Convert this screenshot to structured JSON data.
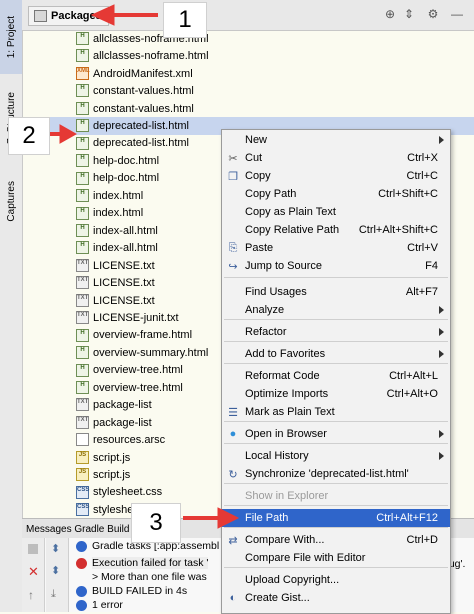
{
  "sidebar": {
    "project_tab": "1: Project",
    "structure_tab": "7: Structure",
    "captures_tab": "Captures"
  },
  "header": {
    "view_label": "Packages"
  },
  "tree": {
    "files": [
      {
        "name": "allclasses-noframe.html",
        "kind": "html"
      },
      {
        "name": "allclasses-noframe.html",
        "kind": "html"
      },
      {
        "name": "AndroidManifest.xml",
        "kind": "xml"
      },
      {
        "name": "constant-values.html",
        "kind": "html"
      },
      {
        "name": "constant-values.html",
        "kind": "html"
      },
      {
        "name": "deprecated-list.html",
        "kind": "html"
      },
      {
        "name": "deprecated-list.html",
        "kind": "html"
      },
      {
        "name": "help-doc.html",
        "kind": "html"
      },
      {
        "name": "help-doc.html",
        "kind": "html"
      },
      {
        "name": "index.html",
        "kind": "html"
      },
      {
        "name": "index.html",
        "kind": "html"
      },
      {
        "name": "index-all.html",
        "kind": "html"
      },
      {
        "name": "index-all.html",
        "kind": "html"
      },
      {
        "name": "LICENSE.txt",
        "kind": "txt"
      },
      {
        "name": "LICENSE.txt",
        "kind": "txt"
      },
      {
        "name": "LICENSE.txt",
        "kind": "txt"
      },
      {
        "name": "LICENSE-junit.txt",
        "kind": "txt"
      },
      {
        "name": "overview-frame.html",
        "kind": "html"
      },
      {
        "name": "overview-summary.html",
        "kind": "html"
      },
      {
        "name": "overview-tree.html",
        "kind": "html"
      },
      {
        "name": "overview-tree.html",
        "kind": "html"
      },
      {
        "name": "package-list",
        "kind": "txt"
      },
      {
        "name": "package-list",
        "kind": "txt"
      },
      {
        "name": "resources.arsc",
        "kind": "arsc"
      },
      {
        "name": "script.js",
        "kind": "js"
      },
      {
        "name": "script.js",
        "kind": "js"
      },
      {
        "name": "stylesheet.css",
        "kind": "css"
      },
      {
        "name": "stylesheet.css",
        "kind": "css"
      }
    ],
    "selected_index": 5
  },
  "messages": {
    "tab_label": "Messages Gradle Build",
    "lines": [
      "Gradle tasks [:app:assembl",
      "Execution failed for task '",
      "> More than one file was",
      "BUILD FAILED in 4s",
      "1 error"
    ],
    "right_fragment": "bug'."
  },
  "context_menu": {
    "items": [
      {
        "label": "New",
        "shortcut": "",
        "submenu": true,
        "icon": ""
      },
      {
        "label": "Cut",
        "shortcut": "Ctrl+X",
        "submenu": false,
        "icon": "scissors-icon"
      },
      {
        "label": "Copy",
        "shortcut": "Ctrl+C",
        "submenu": false,
        "icon": "copy-icon"
      },
      {
        "label": "Copy Path",
        "shortcut": "Ctrl+Shift+C",
        "submenu": false,
        "icon": ""
      },
      {
        "label": "Copy as Plain Text",
        "shortcut": "",
        "submenu": false,
        "icon": ""
      },
      {
        "label": "Copy Relative Path",
        "shortcut": "Ctrl+Alt+Shift+C",
        "submenu": false,
        "icon": ""
      },
      {
        "label": "Paste",
        "shortcut": "Ctrl+V",
        "submenu": false,
        "icon": "paste-icon"
      },
      {
        "label": "Jump to Source",
        "shortcut": "F4",
        "submenu": false,
        "icon": "jump-to-source-icon"
      },
      {
        "label": "Find Usages",
        "shortcut": "Alt+F7",
        "submenu": false,
        "icon": ""
      },
      {
        "label": "Analyze",
        "shortcut": "",
        "submenu": true,
        "icon": ""
      },
      {
        "label": "Refactor",
        "shortcut": "",
        "submenu": true,
        "icon": ""
      },
      {
        "label": "Add to Favorites",
        "shortcut": "",
        "submenu": true,
        "icon": ""
      },
      {
        "label": "Reformat Code",
        "shortcut": "Ctrl+Alt+L",
        "submenu": false,
        "icon": ""
      },
      {
        "label": "Optimize Imports",
        "shortcut": "Ctrl+Alt+O",
        "submenu": false,
        "icon": ""
      },
      {
        "label": "Mark as Plain Text",
        "shortcut": "",
        "submenu": false,
        "icon": "plain-text-icon"
      },
      {
        "label": "Open in Browser",
        "shortcut": "",
        "submenu": true,
        "icon": "globe-icon"
      },
      {
        "label": "Local History",
        "shortcut": "",
        "submenu": true,
        "icon": ""
      },
      {
        "label": "Synchronize 'deprecated-list.html'",
        "shortcut": "",
        "submenu": false,
        "icon": "sync-icon"
      },
      {
        "label": "Show in Explorer",
        "shortcut": "",
        "submenu": false,
        "icon": "",
        "disabled": true
      },
      {
        "label": "File Path",
        "shortcut": "Ctrl+Alt+F12",
        "submenu": false,
        "icon": "",
        "highlighted": true
      },
      {
        "label": "Compare With...",
        "shortcut": "Ctrl+D",
        "submenu": false,
        "icon": "compare-icon"
      },
      {
        "label": "Compare File with Editor",
        "shortcut": "",
        "submenu": false,
        "icon": ""
      },
      {
        "label": "Upload Copyright...",
        "shortcut": "",
        "submenu": false,
        "icon": ""
      },
      {
        "label": "Create Gist...",
        "shortcut": "",
        "submenu": false,
        "icon": "github-icon"
      }
    ]
  },
  "annotations": {
    "step1": "1",
    "step2": "2",
    "step3": "3",
    "arrow_color": "#e53935"
  },
  "colors": {
    "menu_highlight": "#2f65ca",
    "selection": "#c7d5ee",
    "tree_bg": "#fbfbf0"
  }
}
